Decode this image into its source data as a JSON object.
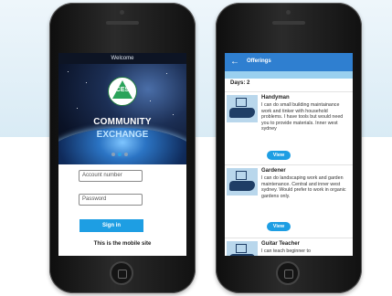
{
  "left_screen": {
    "welcome": "Welcome",
    "logo_text": "CES",
    "brand_line1": "COMMUNITY",
    "brand_line2": "EXCHANGE",
    "carousel_pages": 3,
    "carousel_active": 2,
    "account_placeholder": "Account number",
    "password_placeholder": "Password",
    "signin_label": "Sign in",
    "mobile_note": "This is the mobile site"
  },
  "right_screen": {
    "title": "Offerings",
    "days_label": "Days: 2",
    "offers": [
      {
        "title": "Handyman",
        "description": "I can do small building maintainance work and tinker with household problems. I have tools but would need you to provide materials. Inner west sydney",
        "view_label": "View"
      },
      {
        "title": "Gardener",
        "description": "I can do landscaping work and garden maintenance. Central and inner west sydney. Would prefer to work in organic gardens only.",
        "view_label": "View"
      },
      {
        "title": "Guitar Teacher",
        "description": "I can teach beginner to"
      }
    ]
  },
  "icons": {
    "back": "back-arrow-icon",
    "offer_thumb": "gift-hand-icon"
  },
  "colors": {
    "accent_blue": "#1e9ee3",
    "topbar_blue": "#2f7fd0",
    "logo_green": "#2aa35a"
  }
}
